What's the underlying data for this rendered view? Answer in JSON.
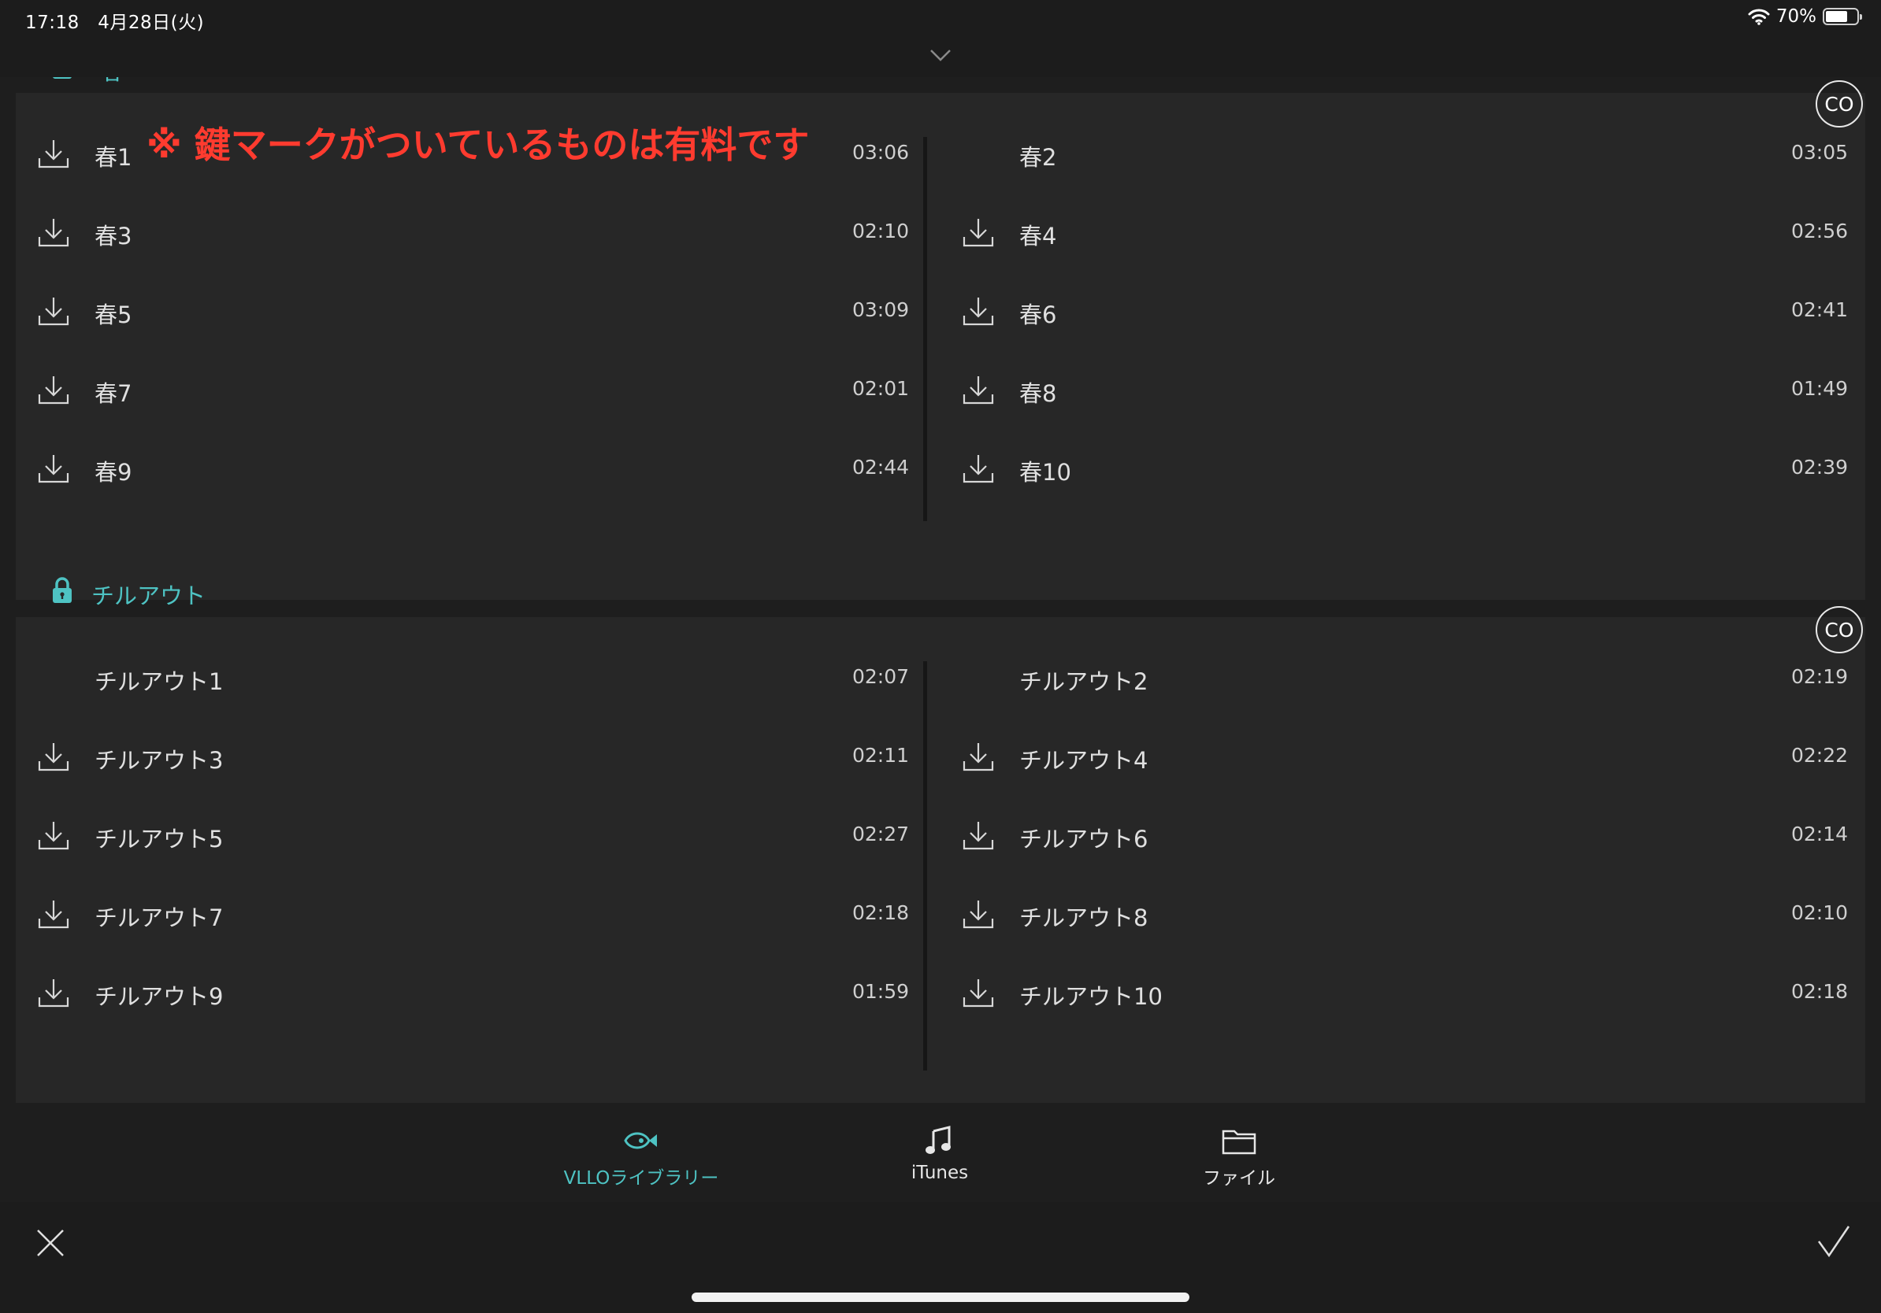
{
  "status_bar": {
    "time_date": "17:18　4月28日(火)",
    "battery": "70%",
    "battery_level": 0.7
  },
  "sections": [
    {
      "title": "春",
      "annotation": "※ 鍵マークがついているものは有料です",
      "co_label": "CO",
      "locked": true,
      "tracks": [
        {
          "name": "春1",
          "duration": "03:06",
          "downloadable": true
        },
        {
          "name": "春2",
          "duration": "03:05",
          "downloadable": false
        },
        {
          "name": "春3",
          "duration": "02:10",
          "downloadable": true
        },
        {
          "name": "春4",
          "duration": "02:56",
          "downloadable": true
        },
        {
          "name": "春5",
          "duration": "03:09",
          "downloadable": true
        },
        {
          "name": "春6",
          "duration": "02:41",
          "downloadable": true
        },
        {
          "name": "春7",
          "duration": "02:01",
          "downloadable": true
        },
        {
          "name": "春8",
          "duration": "01:49",
          "downloadable": true
        },
        {
          "name": "春9",
          "duration": "02:44",
          "downloadable": true
        },
        {
          "name": "春10",
          "duration": "02:39",
          "downloadable": true
        }
      ]
    },
    {
      "title": "チルアウト",
      "co_label": "CO",
      "locked": true,
      "tracks": [
        {
          "name": "チルアウト1",
          "duration": "02:07",
          "downloadable": false
        },
        {
          "name": "チルアウト2",
          "duration": "02:19",
          "downloadable": false
        },
        {
          "name": "チルアウト3",
          "duration": "02:11",
          "downloadable": true
        },
        {
          "name": "チルアウト4",
          "duration": "02:22",
          "downloadable": true
        },
        {
          "name": "チルアウト5",
          "duration": "02:27",
          "downloadable": true
        },
        {
          "name": "チルアウト6",
          "duration": "02:14",
          "downloadable": true
        },
        {
          "name": "チルアウト7",
          "duration": "02:18",
          "downloadable": true
        },
        {
          "name": "チルアウト8",
          "duration": "02:10",
          "downloadable": true
        },
        {
          "name": "チルアウト9",
          "duration": "01:59",
          "downloadable": true
        },
        {
          "name": "チルアウト10",
          "duration": "02:18",
          "downloadable": true
        }
      ]
    }
  ],
  "tabs": [
    {
      "label": "VLLOライブラリー",
      "icon": "fish-icon",
      "active": true
    },
    {
      "label": "iTunes",
      "icon": "music-note-icon",
      "active": false
    },
    {
      "label": "ファイル",
      "icon": "folder-icon",
      "active": false
    }
  ],
  "colors": {
    "accent": "#4ec3c3",
    "annotation": "#ff3b2f",
    "panel": "#272727",
    "background": "#1e1e1e"
  }
}
